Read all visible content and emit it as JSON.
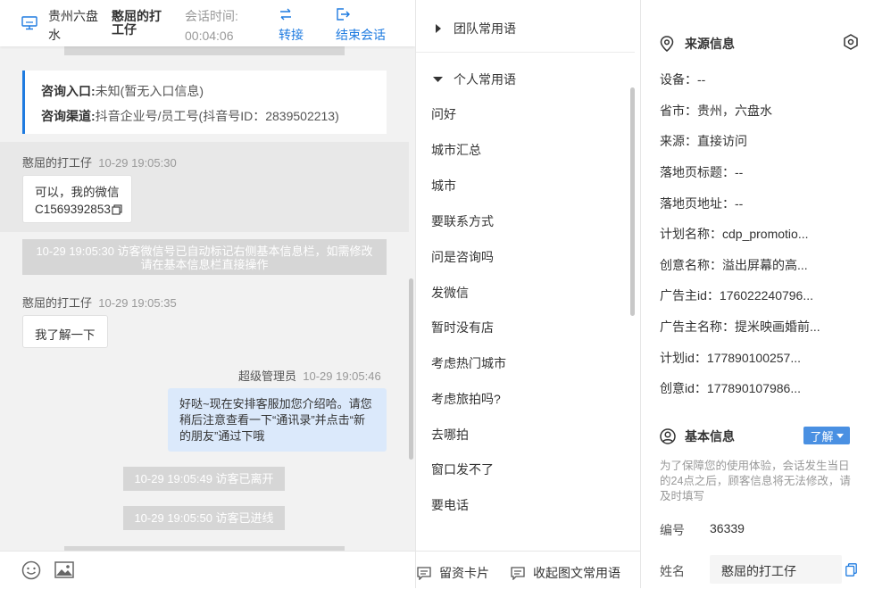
{
  "header": {
    "city": "贵州六盘水",
    "visitor": "憨屈的打工仔",
    "session_label": "会话时间:",
    "session_time": "00:04:06",
    "transfer": "转接",
    "end": "结束会话"
  },
  "source_card": {
    "entry_label": "咨询入口:",
    "entry_value": "未知(暂无入口信息)",
    "channel_label": "咨询渠道:",
    "channel_value": "抖音企业号/员工号(抖音号ID：2839502213)"
  },
  "messages": [
    {
      "sender": "憨屈的打工仔",
      "time": "10-29 19:05:30",
      "line1": "可以，我的微信",
      "line2": "C1569392853"
    },
    {
      "note": "10-29 19:05:30 访客微信号已自动标记右侧基本信息栏，如需修改请在基本信息栏直接操作"
    },
    {
      "sender": "憨屈的打工仔",
      "time": "10-29 19:05:35",
      "text": "我了解一下"
    },
    {
      "sender": "超级管理员",
      "time": "10-29 19:05:46",
      "text": "好哒~现在安排客服加您介绍哈。请您稍后注意查看一下“通讯录”并点击“新的朋友”通过下哦"
    },
    {
      "note": "10-29 19:05:49 访客已离开"
    },
    {
      "note": "10-29 19:05:50 访客已进线"
    }
  ],
  "phrases": {
    "team_title": "团队常用语",
    "personal_title": "个人常用语",
    "items": [
      "问好",
      "城市汇总",
      "城市",
      "要联系方式",
      "问是咨询吗",
      "发微信",
      "暂时没有店",
      "考虑热门城市",
      "考虑旅拍吗?",
      "去哪拍",
      "窗口发不了",
      "要电话"
    ]
  },
  "footer": {
    "card": "留资卡片",
    "collapse": "收起图文常用语"
  },
  "source_info": {
    "title": "来源信息",
    "rows": [
      {
        "label": "设备：",
        "value": "--"
      },
      {
        "label": "省市：",
        "value": "贵州，六盘水"
      },
      {
        "label": "来源：",
        "value": "直接访问"
      },
      {
        "label": "落地页标题：",
        "value": "--"
      },
      {
        "label": "落地页地址：",
        "value": "--"
      },
      {
        "label": "计划名称：",
        "value": "cdp_promotio..."
      },
      {
        "label": "创意名称：",
        "value": "溢出屏幕的高..."
      },
      {
        "label": "广告主id：",
        "value": "176022240796..."
      },
      {
        "label": "广告主名称：",
        "value": "提米映画婚前..."
      },
      {
        "label": "计划id：",
        "value": "177890100257..."
      },
      {
        "label": "创意id：",
        "value": "177890107986..."
      }
    ]
  },
  "basic_info": {
    "title": "基本信息",
    "learn_btn": "了解",
    "notice": "为了保障您的使用体验，会话发生当日的24点之后，顾客信息将无法修改，请及时填写",
    "id_label": "编号",
    "id_value": "36339",
    "name_label": "姓名",
    "name_value": "憨屈的打工仔"
  },
  "colors": {
    "accent": "#1e7be0",
    "visitor_bubble": "#ffffff",
    "agent_bubble": "#dbe9fb",
    "note_bg": "#d6d6d6"
  }
}
